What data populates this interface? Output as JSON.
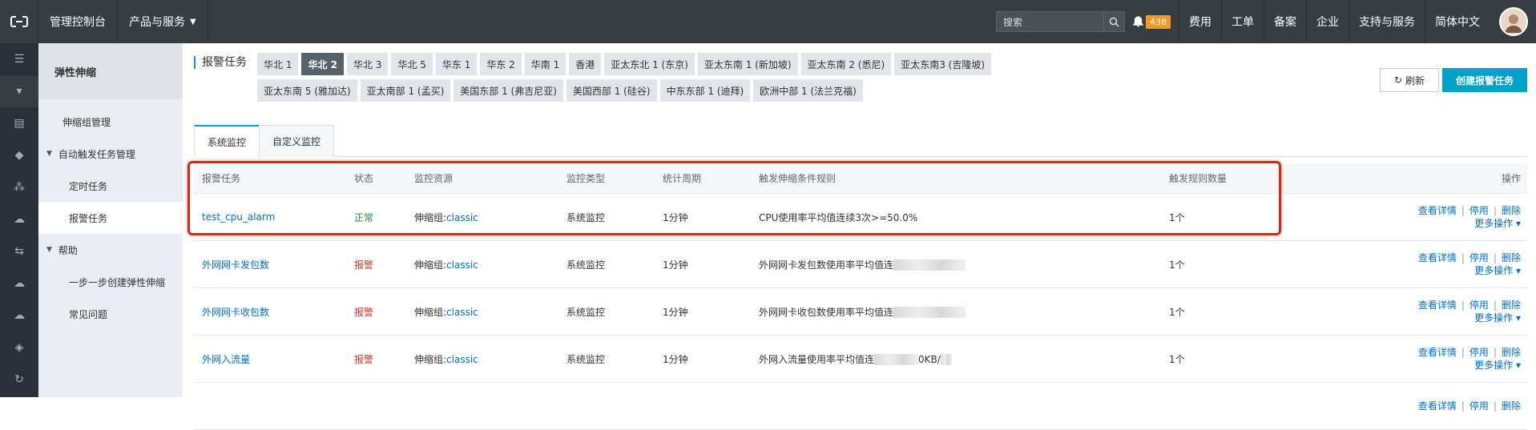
{
  "topbar": {
    "console": "管理控制台",
    "products": "产品与服务",
    "search_placeholder": "搜索",
    "badge": "438",
    "items": [
      "费用",
      "工单",
      "备案",
      "企业",
      "支持与服务",
      "简体中文"
    ]
  },
  "sidebar": {
    "title": "弹性伸缩",
    "item_group": "伸缩组管理",
    "group_trigger": "自动触发任务管理",
    "sub_scheduled": "定时任务",
    "sub_alarm": "报警任务",
    "group_help": "帮助",
    "sub_guide": "一步一步创建弹性伸缩",
    "sub_faq": "常见问题"
  },
  "main": {
    "title": "报警任务",
    "regions": [
      "华北 1",
      "华北 2",
      "华北 3",
      "华北 5",
      "华东 1",
      "华东 2",
      "华南 1",
      "香港",
      "亚太东北 1 (东京)",
      "亚太东南 1 (新加坡)",
      "亚太东南 2 (悉尼)",
      "亚太东南3 (吉隆坡)",
      "亚太东南 5 (雅加达)",
      "亚太南部 1 (孟买)",
      "美国东部 1 (弗吉尼亚)",
      "美国西部 1 (硅谷)",
      "中东东部 1 (迪拜)",
      "欧洲中部 1 (法兰克福)"
    ],
    "active_region": "华北 2",
    "refresh": "刷新",
    "create": "创建报警任务",
    "tabs": [
      "系统监控",
      "自定义监控"
    ]
  },
  "table": {
    "headers": [
      "报警任务",
      "状态",
      "监控资源",
      "监控类型",
      "统计周期",
      "触发伸缩条件规则",
      "触发规则数量",
      "操作"
    ],
    "rows": [
      {
        "name": "test_cpu_alarm",
        "status": "正常",
        "res_prefix": "伸缩组:",
        "res_link": "classic",
        "type": "系统监控",
        "period": "1分钟",
        "rule": "CPU使用率平均值连续3次>=50.0%",
        "count": "1个"
      },
      {
        "name": "外网网卡发包数",
        "status": "报警",
        "res_prefix": "伸缩组:",
        "res_link": "classic",
        "type": "系统监控",
        "period": "1分钟",
        "rule": "外网网卡发包数使用率平均值连",
        "count": "1个"
      },
      {
        "name": "外网网卡收包数",
        "status": "报警",
        "res_prefix": "伸缩组:",
        "res_link": "classic",
        "type": "系统监控",
        "period": "1分钟",
        "rule": "外网网卡收包数使用率平均值连",
        "count": "1个"
      },
      {
        "name": "外网入流量",
        "status": "报警",
        "res_prefix": "伸缩组:",
        "res_link": "classic",
        "type": "系统监控",
        "period": "1分钟",
        "rule": "外网入流量使用率平均值连",
        "rule_suffix": "0KB/",
        "count": "1个"
      }
    ],
    "op_detail": "查看详情",
    "op_stop": "停用",
    "op_delete": "删除",
    "op_more": "更多操作"
  },
  "colors": {
    "accent": "#00a2ca",
    "topbar": "#373d41",
    "highlight": "#d9261c"
  }
}
